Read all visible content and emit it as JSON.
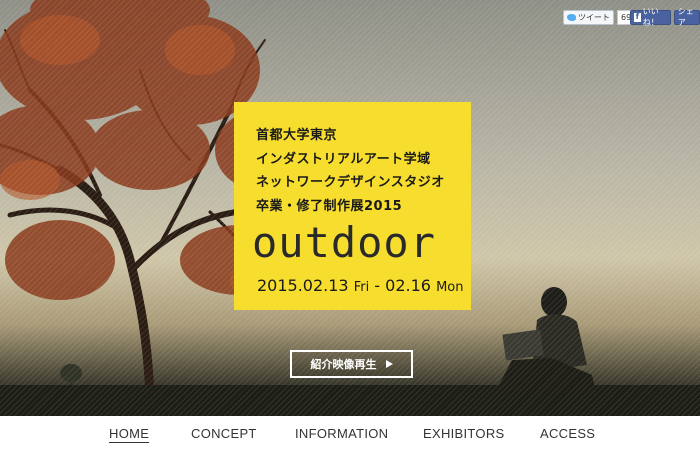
{
  "social": {
    "tweet_label": "ツイート",
    "tweet_count": "69",
    "like_label": "いいね！",
    "share_label": "シェア"
  },
  "panel": {
    "lines": [
      "首都大学東京",
      "インダストリアルアート学域",
      "ネットワークデザインスタジオ",
      "卒業・修了制作展2015"
    ],
    "logo": "outdoor",
    "date_start": "2015.02.13",
    "date_start_day": "Fri",
    "date_sep": " - ",
    "date_end": "02.16",
    "date_end_day": "Mon",
    "accent": "#f7de2e"
  },
  "video_button": {
    "label": "紹介映像再生"
  },
  "nav": {
    "items": [
      {
        "label": "HOME",
        "active": true
      },
      {
        "label": "CONCEPT",
        "active": false
      },
      {
        "label": "INFORMATION",
        "active": false
      },
      {
        "label": "EXHIBITORS",
        "active": false
      },
      {
        "label": "ACCESS",
        "active": false
      }
    ]
  }
}
